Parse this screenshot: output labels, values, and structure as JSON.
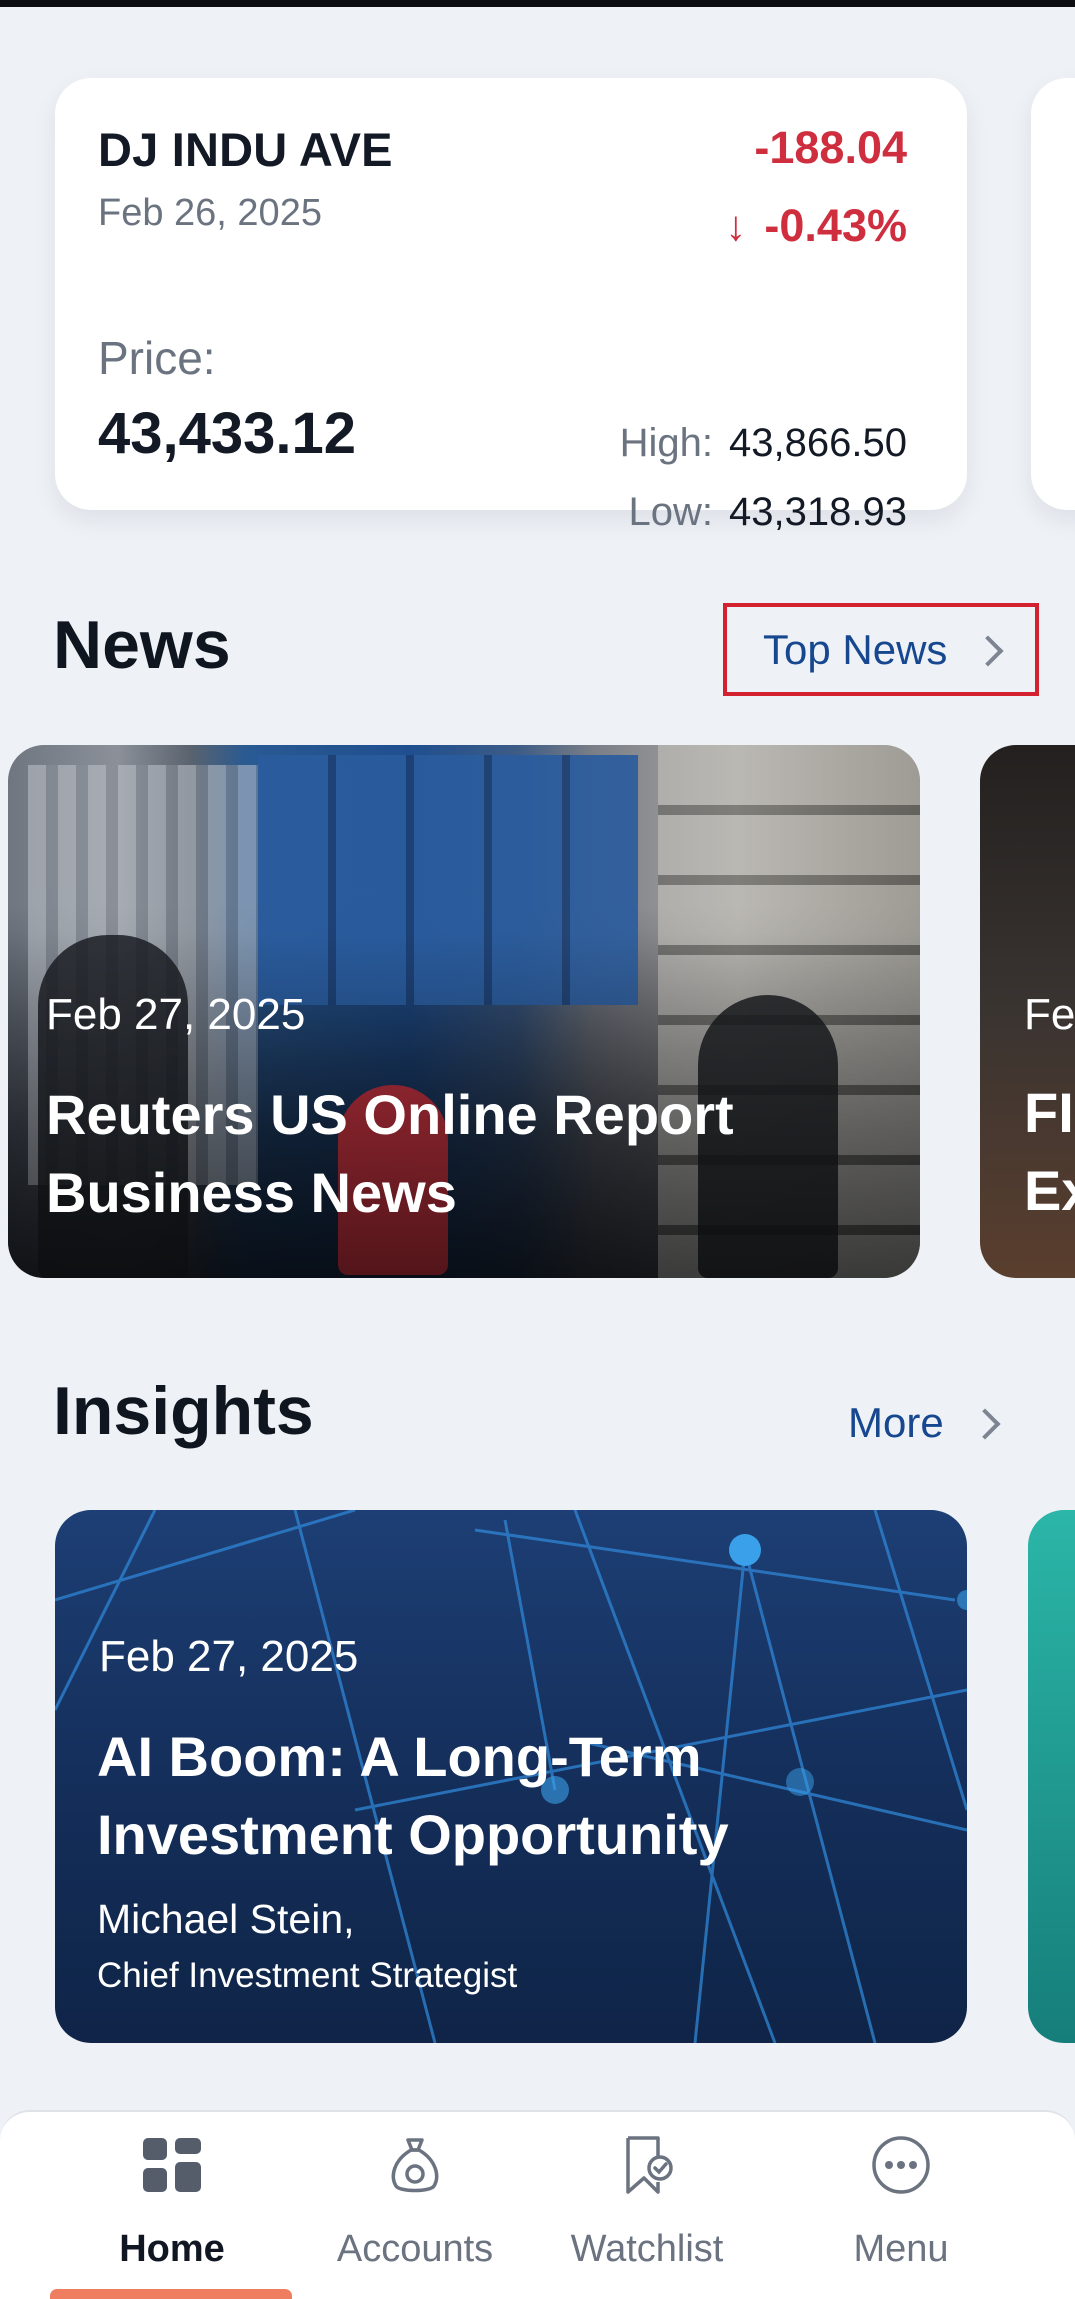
{
  "market": {
    "name": "DJ INDU AVE",
    "date": "Feb 26, 2025",
    "change": "-188.04",
    "change_arrow": "↓",
    "change_pct": "-0.43%",
    "price_label": "Price:",
    "price": "43,433.12",
    "high_label": "High:",
    "high": "43,866.50",
    "low_label": "Low:",
    "low": "43,318.93",
    "negative_color": "#cf2e3f"
  },
  "news": {
    "title": "News",
    "link_label": "Top News",
    "items": [
      {
        "date": "Feb 27, 2025",
        "title": "Reuters US Online Report Business News"
      },
      {
        "date": "Fe",
        "title_line1": "FI",
        "title_line2": "Ex"
      }
    ]
  },
  "insights": {
    "title": "Insights",
    "link_label": "More",
    "items": [
      {
        "date": "Feb 27, 2025",
        "title": "AI Boom: A Long-Term Investment Opportunity",
        "author": "Michael Stein,",
        "role": "Chief Investment Strategist"
      }
    ]
  },
  "nav": {
    "items": [
      {
        "label": "Home",
        "icon": "grid-icon",
        "active": true
      },
      {
        "label": "Accounts",
        "icon": "money-bag-icon"
      },
      {
        "label": "Watchlist",
        "icon": "bookmark-check-icon"
      },
      {
        "label": "Menu",
        "icon": "more-dots-icon"
      }
    ],
    "accent_color": "#ef7d5f"
  }
}
